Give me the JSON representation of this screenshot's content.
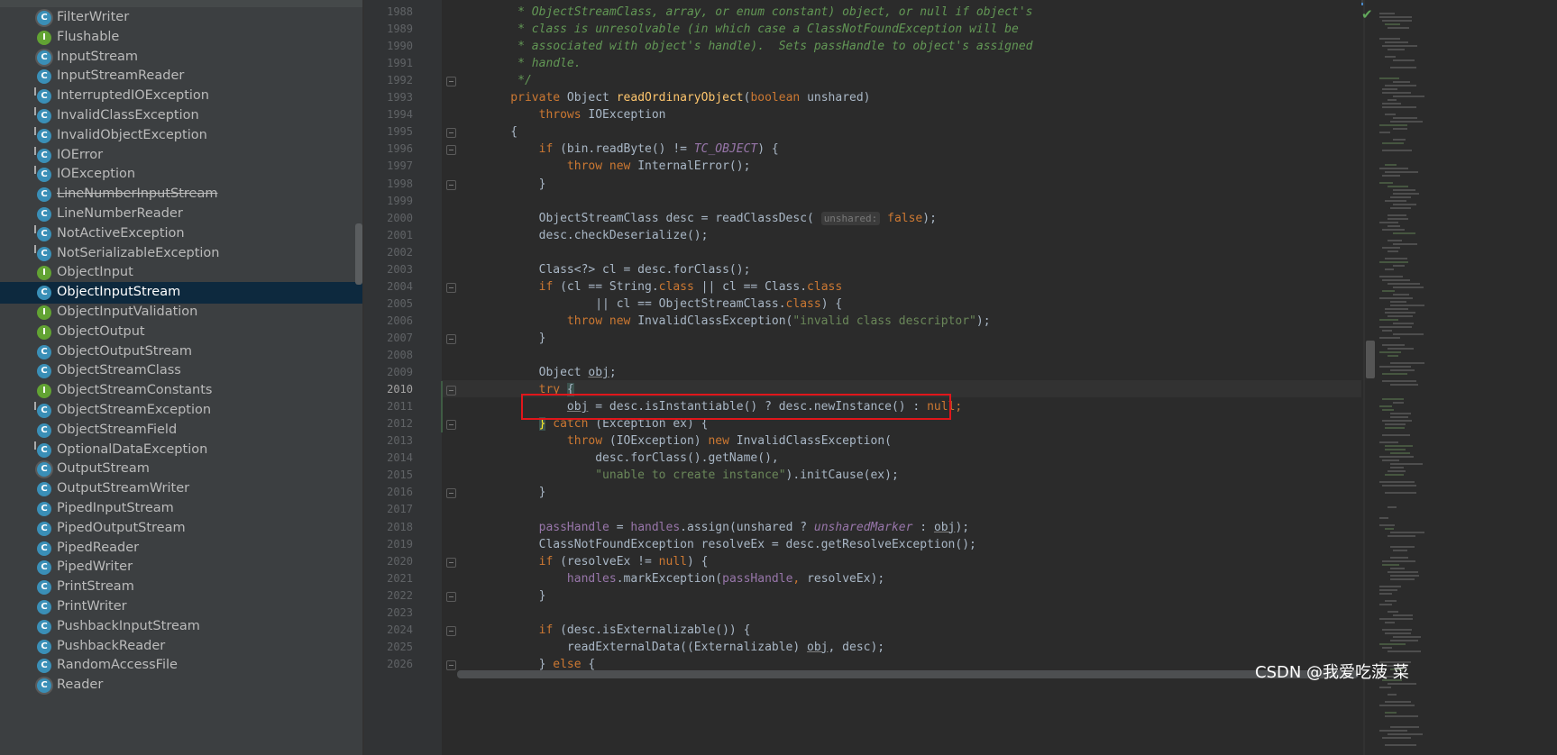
{
  "project_tree": {
    "items": [
      {
        "label": "FilterWriter",
        "kind": "abstract"
      },
      {
        "label": "Flushable",
        "kind": "interface"
      },
      {
        "label": "InputStream",
        "kind": "abstract"
      },
      {
        "label": "InputStreamReader",
        "kind": "class"
      },
      {
        "label": "InterruptedIOException",
        "kind": "exception"
      },
      {
        "label": "InvalidClassException",
        "kind": "exception"
      },
      {
        "label": "InvalidObjectException",
        "kind": "exception"
      },
      {
        "label": "IOError",
        "kind": "exception"
      },
      {
        "label": "IOException",
        "kind": "exception"
      },
      {
        "label": "LineNumberInputStream",
        "kind": "class",
        "deprecated": true
      },
      {
        "label": "LineNumberReader",
        "kind": "class"
      },
      {
        "label": "NotActiveException",
        "kind": "exception"
      },
      {
        "label": "NotSerializableException",
        "kind": "exception"
      },
      {
        "label": "ObjectInput",
        "kind": "interface"
      },
      {
        "label": "ObjectInputStream",
        "kind": "class",
        "selected": true
      },
      {
        "label": "ObjectInputValidation",
        "kind": "interface"
      },
      {
        "label": "ObjectOutput",
        "kind": "interface"
      },
      {
        "label": "ObjectOutputStream",
        "kind": "class"
      },
      {
        "label": "ObjectStreamClass",
        "kind": "class"
      },
      {
        "label": "ObjectStreamConstants",
        "kind": "interface"
      },
      {
        "label": "ObjectStreamException",
        "kind": "exception"
      },
      {
        "label": "ObjectStreamField",
        "kind": "class"
      },
      {
        "label": "OptionalDataException",
        "kind": "exception"
      },
      {
        "label": "OutputStream",
        "kind": "abstract"
      },
      {
        "label": "OutputStreamWriter",
        "kind": "class"
      },
      {
        "label": "PipedInputStream",
        "kind": "class"
      },
      {
        "label": "PipedOutputStream",
        "kind": "class"
      },
      {
        "label": "PipedReader",
        "kind": "class"
      },
      {
        "label": "PipedWriter",
        "kind": "class"
      },
      {
        "label": "PrintStream",
        "kind": "class"
      },
      {
        "label": "PrintWriter",
        "kind": "class"
      },
      {
        "label": "PushbackInputStream",
        "kind": "class"
      },
      {
        "label": "PushbackReader",
        "kind": "class"
      },
      {
        "label": "RandomAccessFile",
        "kind": "class"
      },
      {
        "label": "Reader",
        "kind": "abstract"
      }
    ],
    "icon_letters": {
      "class": "C",
      "interface": "I",
      "exception": "C",
      "abstract": "C"
    }
  },
  "editor": {
    "current_line": "2010",
    "lines": [
      {
        "n": "1988",
        "segs": [
          [
            "cm",
            "     * ObjectStreamClass, array, or enum constant) object, or null if object's"
          ]
        ]
      },
      {
        "n": "1989",
        "segs": [
          [
            "cm",
            "     * class is unresolvable (in which case a ClassNotFoundException will be"
          ]
        ]
      },
      {
        "n": "1990",
        "segs": [
          [
            "cm",
            "     * associated with object's handle).  Sets passHandle to object's assigned"
          ]
        ]
      },
      {
        "n": "1991",
        "segs": [
          [
            "cm",
            "     * handle."
          ]
        ]
      },
      {
        "n": "1992",
        "segs": [
          [
            "cm",
            "     */"
          ]
        ]
      },
      {
        "n": "1993",
        "segs": [
          [
            "kw",
            "    private "
          ],
          [
            "",
            "Object "
          ],
          [
            "fn",
            "readOrdinaryObject"
          ],
          [
            "",
            "("
          ],
          [
            "kw",
            "boolean "
          ],
          [
            "",
            "unshared)"
          ]
        ]
      },
      {
        "n": "1994",
        "segs": [
          [
            "kw",
            "        throws "
          ],
          [
            "",
            "IOException"
          ]
        ]
      },
      {
        "n": "1995",
        "segs": [
          [
            "",
            "    {"
          ]
        ]
      },
      {
        "n": "1996",
        "segs": [
          [
            "kw",
            "        if "
          ],
          [
            "",
            "(bin.readByte() != "
          ],
          [
            "cn",
            "TC_OBJECT"
          ],
          [
            "",
            ") {"
          ]
        ]
      },
      {
        "n": "1997",
        "segs": [
          [
            "kw",
            "            throw new "
          ],
          [
            "",
            "InternalError();"
          ]
        ]
      },
      {
        "n": "1998",
        "segs": [
          [
            "",
            "        }"
          ]
        ]
      },
      {
        "n": "1999",
        "segs": [
          [
            "",
            ""
          ]
        ]
      },
      {
        "n": "2000",
        "segs": [
          [
            "",
            "        ObjectStreamClass desc = readClassDesc( "
          ],
          [
            "hint",
            "unshared:"
          ],
          [
            "kw",
            " false"
          ],
          [
            "",
            ");"
          ]
        ]
      },
      {
        "n": "2001",
        "segs": [
          [
            "",
            "        desc.checkDeserialize();"
          ]
        ]
      },
      {
        "n": "2002",
        "segs": [
          [
            "",
            ""
          ]
        ]
      },
      {
        "n": "2003",
        "segs": [
          [
            "",
            "        Class<?> cl = desc.forClass();"
          ]
        ]
      },
      {
        "n": "2004",
        "segs": [
          [
            "kw",
            "        if "
          ],
          [
            "",
            "(cl == String."
          ],
          [
            "kw",
            "class "
          ],
          [
            "",
            "|| cl == Class."
          ],
          [
            "kw",
            "class"
          ]
        ]
      },
      {
        "n": "2005",
        "segs": [
          [
            "",
            "                || cl == ObjectStreamClass."
          ],
          [
            "kw",
            "class"
          ],
          [
            "",
            ") {"
          ]
        ]
      },
      {
        "n": "2006",
        "segs": [
          [
            "kw",
            "            throw new "
          ],
          [
            "",
            "InvalidClassException("
          ],
          [
            "st",
            "\"invalid class descriptor\""
          ],
          [
            "",
            ");"
          ]
        ]
      },
      {
        "n": "2007",
        "segs": [
          [
            "",
            "        }"
          ]
        ]
      },
      {
        "n": "2008",
        "segs": [
          [
            "",
            ""
          ]
        ]
      },
      {
        "n": "2009",
        "segs": [
          [
            "",
            "        Object "
          ],
          [
            "ul",
            "obj"
          ],
          [
            "",
            ";"
          ]
        ]
      },
      {
        "n": "2010",
        "segs": [
          [
            "kw",
            "        try "
          ],
          [
            "brace-hl",
            "{"
          ]
        ]
      },
      {
        "n": "2011",
        "segs": [
          [
            "",
            "            "
          ],
          [
            "ul",
            "obj"
          ],
          [
            "",
            " = desc.isInstantiable() ? desc.newInstance() : "
          ],
          [
            "kw",
            "null"
          ],
          [
            "kw",
            ";"
          ]
        ]
      },
      {
        "n": "2012",
        "segs": [
          [
            "",
            "        "
          ],
          [
            "brace-hl2",
            "}"
          ],
          [
            "kw",
            " catch "
          ],
          [
            "",
            "(Exception ex) {"
          ]
        ]
      },
      {
        "n": "2013",
        "segs": [
          [
            "kw",
            "            throw "
          ],
          [
            "",
            "(IOException) "
          ],
          [
            "kw",
            "new "
          ],
          [
            "",
            "InvalidClassException("
          ]
        ]
      },
      {
        "n": "2014",
        "segs": [
          [
            "",
            "                desc.forClass().getName(),"
          ]
        ]
      },
      {
        "n": "2015",
        "segs": [
          [
            "st",
            "                \"unable to create instance\""
          ],
          [
            "",
            ").initCause(ex);"
          ]
        ]
      },
      {
        "n": "2016",
        "segs": [
          [
            "",
            "        }"
          ]
        ]
      },
      {
        "n": "2017",
        "segs": [
          [
            "",
            ""
          ]
        ]
      },
      {
        "n": "2018",
        "segs": [
          [
            "fld",
            "        passHandle "
          ],
          [
            "",
            "= "
          ],
          [
            "fld",
            "handles"
          ],
          [
            "",
            ".assign(unshared ? "
          ],
          [
            "cn",
            "unsharedMarker"
          ],
          [
            "",
            " : "
          ],
          [
            "ul",
            "obj"
          ],
          [
            "",
            ");"
          ]
        ]
      },
      {
        "n": "2019",
        "segs": [
          [
            "",
            "        ClassNotFoundException resolveEx = desc.getResolveException();"
          ]
        ]
      },
      {
        "n": "2020",
        "segs": [
          [
            "kw",
            "        if "
          ],
          [
            "",
            "(resolveEx != "
          ],
          [
            "kw",
            "null"
          ],
          [
            "",
            ") {"
          ]
        ]
      },
      {
        "n": "2021",
        "segs": [
          [
            "fld",
            "            handles"
          ],
          [
            "",
            ".markException("
          ],
          [
            "fld",
            "passHandle"
          ],
          [
            "kw",
            ", "
          ],
          [
            "",
            "resolveEx);"
          ]
        ]
      },
      {
        "n": "2022",
        "segs": [
          [
            "",
            "        }"
          ]
        ]
      },
      {
        "n": "2023",
        "segs": [
          [
            "",
            ""
          ]
        ]
      },
      {
        "n": "2024",
        "segs": [
          [
            "kw",
            "        if "
          ],
          [
            "",
            "(desc.isExternalizable()) {"
          ]
        ]
      },
      {
        "n": "2025",
        "segs": [
          [
            "",
            "            readExternalData((Externalizable) "
          ],
          [
            "ul",
            "obj"
          ],
          [
            "",
            ", desc);"
          ]
        ]
      },
      {
        "n": "2026",
        "segs": [
          [
            "",
            "        } "
          ],
          [
            "kw",
            "else "
          ],
          [
            "",
            "{"
          ]
        ]
      }
    ],
    "fold_lines": [
      "1992",
      "1995",
      "1996",
      "1998",
      "2004",
      "2007",
      "2010",
      "2012",
      "2016",
      "2020",
      "2022",
      "2024",
      "2026"
    ]
  },
  "status": {
    "inspection_icon": "check-icon"
  },
  "watermark": "CSDN @我爱吃菠 菜",
  "colors": {
    "keyword": "#cc7832",
    "comment": "#629755",
    "method": "#ffc66d",
    "string": "#6a8759",
    "constant": "#9876aa",
    "highlight_box": "#e0161b",
    "selection": "#0d293e"
  }
}
